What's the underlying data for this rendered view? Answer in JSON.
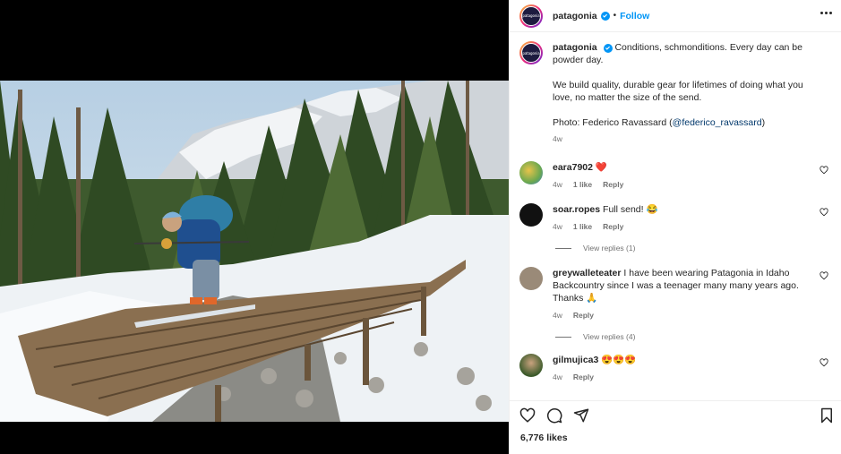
{
  "account": {
    "username": "patagonia",
    "avatar_text": "patagonia",
    "follow_label": "Follow",
    "separator": "•"
  },
  "caption": {
    "username": "patagonia",
    "line1": "Conditions, schmonditions. Every day can be powder day.",
    "line2": "We build quality, durable gear for lifetimes of doing what you love, no matter the size of the send.",
    "photo_prefix": "Photo: Federico Ravassard (",
    "photo_handle": "@federico_ravassard",
    "photo_suffix": ")",
    "time": "4w"
  },
  "comments": [
    {
      "username": "eara7902",
      "text": "",
      "emoji": "❤️",
      "time": "4w",
      "likes": "1 like",
      "reply": "Reply",
      "avatar_color": "#c89a3c"
    },
    {
      "username": "soar.ropes",
      "text": "Full send! 😂",
      "emoji": "",
      "time": "4w",
      "likes": "1 like",
      "reply": "Reply",
      "avatar_color": "#111111",
      "view_replies": "View replies (1)"
    },
    {
      "username": "greywalleteater",
      "text": "I have been wearing Patagonia in Idaho Backcountry since I was a teenager many many years ago. Thanks 🙏",
      "emoji": "",
      "time": "4w",
      "likes": "",
      "reply": "Reply",
      "avatar_color": "#9a8a78",
      "view_replies": "View replies (4)"
    },
    {
      "username": "gilmujica3",
      "text": "😍😍😍",
      "emoji": "",
      "time": "4w",
      "likes": "",
      "reply": "Reply",
      "avatar_color": "#3b5a2a"
    }
  ],
  "footer": {
    "likes_label": "6,776 likes"
  },
  "icons": [
    "heart-icon",
    "comment-icon",
    "share-icon",
    "bookmark-icon",
    "more-icon",
    "verified-icon"
  ],
  "colors": {
    "accent": "#0095f6",
    "link": "#00376b",
    "muted": "#737373"
  }
}
